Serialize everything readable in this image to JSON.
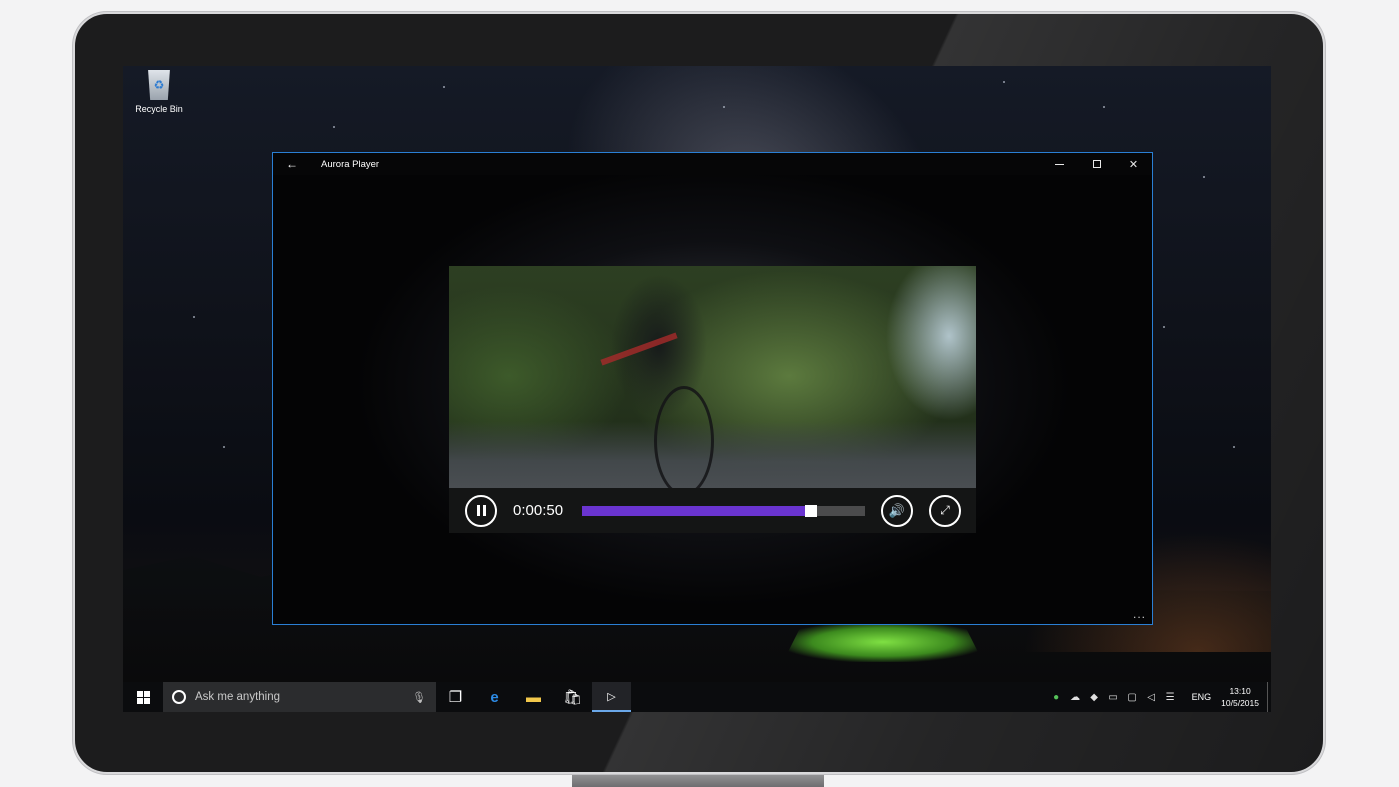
{
  "desktop": {
    "recycle_bin_label": "Recycle Bin"
  },
  "window": {
    "title": "Aurora Player",
    "back_icon": "back-arrow-icon",
    "minimize_icon": "minimize-icon",
    "maximize_icon": "maximize-icon",
    "close_icon": "close-icon",
    "more_label": "..."
  },
  "player": {
    "current_time": "0:00:50",
    "progress": 0.81,
    "accent_color": "#6a34d0",
    "pause_icon": "pause-icon",
    "volume_icon": "volume-icon",
    "fullscreen_icon": "fullscreen-icon"
  },
  "taskbar": {
    "search_placeholder": "Ask me anything",
    "apps": [
      "task-view-icon",
      "edge-icon",
      "file-explorer-icon",
      "store-icon",
      "aurora-player-icon"
    ],
    "language": "ENG",
    "time": "13:10",
    "date": "10/5/2015"
  }
}
